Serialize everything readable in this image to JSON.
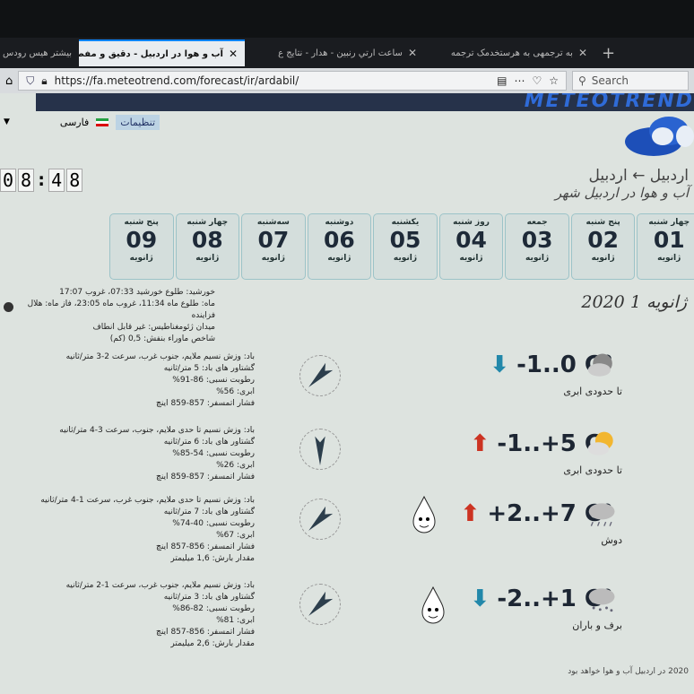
{
  "browser": {
    "tabs": [
      {
        "title": "بيشتر هيس رودس",
        "active": false
      },
      {
        "title": "آب و هوا در اردبیل - دقیق و مفصل پ",
        "active": true
      },
      {
        "title": "ساعت ارتي رنبین - هدار - نتایج ع",
        "active": false
      },
      {
        "title": "به ترجمهی به هرستخدمک ترجمه",
        "active": false
      }
    ],
    "new_tab": "+",
    "url": "https://fa.meteotrend.com/forecast/ir/ardabil/",
    "search_placeholder": "Search"
  },
  "site": {
    "logo": "METEOTREND",
    "settings_label": "تنظیمات",
    "language": "فارسی",
    "clock": [
      "0",
      "8",
      ":",
      "4",
      "8"
    ],
    "breadcrumb": "اردبیل ← اردبیل",
    "subtitle": "آب و هوا در اردبیل شهر",
    "days": [
      {
        "weekday": "چهار شنبه",
        "num": "01",
        "month": "ژانویه"
      },
      {
        "weekday": "پنج شنبه",
        "num": "02",
        "month": "ژانویه"
      },
      {
        "weekday": "جمعه",
        "num": "03",
        "month": "ژانویه"
      },
      {
        "weekday": "روز شنبه",
        "num": "04",
        "month": "ژانویه"
      },
      {
        "weekday": "یکشنبه",
        "num": "05",
        "month": "ژانویه"
      },
      {
        "weekday": "دوشنبه",
        "num": "06",
        "month": "ژانویه"
      },
      {
        "weekday": "سه‌شنبه",
        "num": "07",
        "month": "ژانویه"
      },
      {
        "weekday": "چهار شنبه",
        "num": "08",
        "month": "ژانویه"
      },
      {
        "weekday": "پنج شنبه",
        "num": "09",
        "month": "ژانویه"
      }
    ],
    "date_heading": "ژانویه 1 2020",
    "astro": {
      "sun": "خورشید: طلوع خورشید 07:33، غروب 17:07",
      "moon": "ماه: طلوع ماه 11:34، غروب ماه 23:05، فاز ماه: هلال فزاینده",
      "magnetic": "میدان ژئومغناطیس: غیر قابل انطاف",
      "uv": "شاخص ماوراء بنفش: 0,5 (کم)"
    },
    "periods": [
      {
        "temp": "-1..0 C°",
        "trend": "down",
        "condition": "تا حدودی ابری",
        "icon": "cloudy-night-icon",
        "wind": "باد: وزش نسیم ملایم، جنوب غرب، سرعت 2-3 متر/ثانیه",
        "gust": "گشتاور های باد: 5 متر/ثانیه",
        "humidity": "رطوبت نسبی: 86-91%",
        "cloud": "ابری: 56%",
        "pressure": "فشار اتمسفر: 857-859 اینچ",
        "precip": "",
        "compass_deg": 225,
        "drop": false
      },
      {
        "temp": "-1..+5 C°",
        "trend": "up",
        "condition": "تا حدودی ابری",
        "icon": "partly-sunny-icon",
        "wind": "باد: وزش نسیم تا حدی ملایم، جنوب، سرعت 3-4 متر/ثانیه",
        "gust": "گشتاور های باد: 6 متر/ثانیه",
        "humidity": "رطوبت نسبی: 54-85%",
        "cloud": "ابری: 26%",
        "pressure": "فشار اتمسفر: 857-859 اینچ",
        "precip": "",
        "compass_deg": 180,
        "drop": false
      },
      {
        "temp": "+2..+7 C°",
        "trend": "up",
        "condition": "دوش",
        "icon": "rain-shower-icon",
        "wind": "باد: وزش نسیم تا حدی ملایم، جنوب غرب، سرعت 1-4 متر/ثانیه",
        "gust": "گشتاور های باد: 7 متر/ثانیه",
        "humidity": "رطوبت نسبی: 40-74%",
        "cloud": "ابری: 67%",
        "pressure": "فشار اتمسفر: 856-857 اینچ",
        "precip": "مقدار بارش: 1,6 میلیمتر",
        "compass_deg": 225,
        "drop": true
      },
      {
        "temp": "-2..+1 C°",
        "trend": "down",
        "condition": "برف و باران",
        "icon": "sleet-icon",
        "wind": "باد: وزش نسیم ملایم، جنوب غرب، سرعت 1-2 متر/ثانیه",
        "gust": "گشتاور های باد: 3 متر/ثانیه",
        "humidity": "رطوبت نسبی: 82-86%",
        "cloud": "ابری: 81%",
        "pressure": "فشار اتمسفر: 856-857 اینچ",
        "precip": "مقدار بارش: 2,6 میلیمتر",
        "compass_deg": 225,
        "drop": true
      }
    ],
    "footer": "2020 در اردبیل آب و هوا خواهد بود"
  }
}
